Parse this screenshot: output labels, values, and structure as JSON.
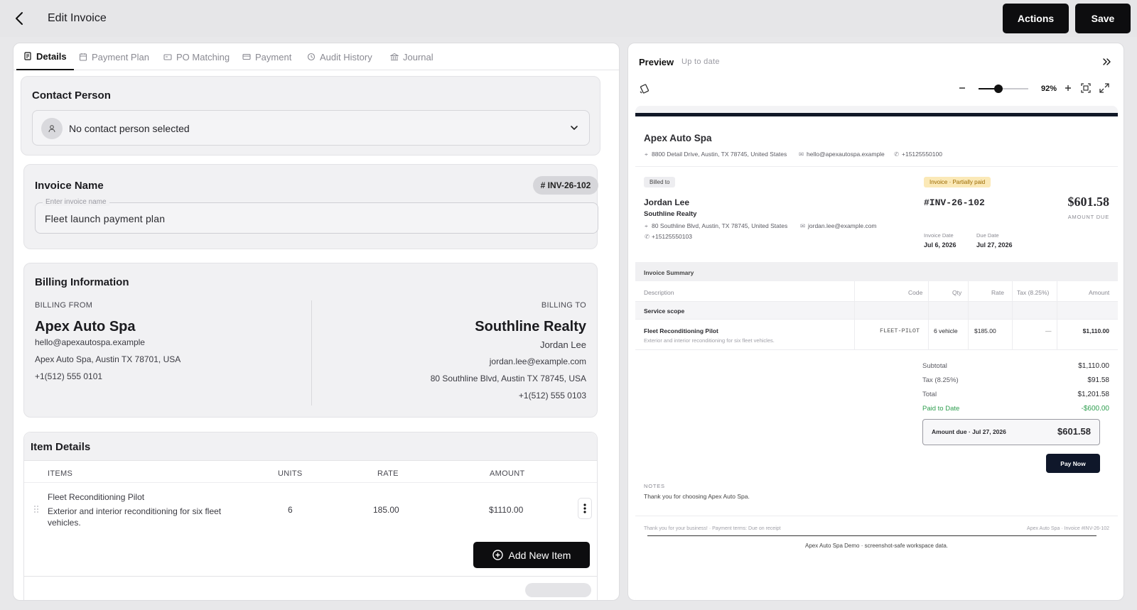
{
  "header": {
    "title": "Edit Invoice",
    "actions_label": "Actions",
    "save_label": "Save"
  },
  "tabs": [
    {
      "label": "Details",
      "icon": "document-icon",
      "active": true
    },
    {
      "label": "Payment Plan",
      "icon": "calendar-icon"
    },
    {
      "label": "PO Matching",
      "icon": "match-icon"
    },
    {
      "label": "Payment",
      "icon": "card-icon"
    },
    {
      "label": "Audit History",
      "icon": "history-icon"
    },
    {
      "label": "Journal",
      "icon": "bank-icon"
    }
  ],
  "contact": {
    "title": "Contact Person",
    "value": "No contact person selected"
  },
  "invoice_name": {
    "title": "Invoice Name",
    "badge": "# INV-26-102",
    "field_label": "Enter invoice name",
    "value": "Fleet launch payment plan"
  },
  "billing": {
    "title": "Billing Information",
    "from": {
      "label": "BILLING FROM",
      "name": "Apex Auto Spa",
      "email": "hello@apexautospa.example",
      "address": "Apex Auto Spa, Austin TX 78701, USA",
      "phone": "+1(512) 555 0101"
    },
    "to": {
      "label": "BILLING TO",
      "name": "Southline Realty",
      "contact": "Jordan Lee",
      "email": "jordan.lee@example.com",
      "address": "80 Southline Blvd, Austin TX 78745, USA",
      "phone": "+1(512) 555 0103"
    }
  },
  "items": {
    "title": "Item Details",
    "headers": {
      "items": "ITEMS",
      "units": "UNITS",
      "rate": "RATE",
      "amount": "AMOUNT"
    },
    "rows": [
      {
        "name": "Fleet Reconditioning Pilot",
        "description_line1": "Exterior and interior reconditioning for six fleet",
        "description_line2": "vehicles.",
        "units": "6",
        "rate": "185.00",
        "amount": "$1110.00"
      }
    ],
    "add_label": "Add New Item"
  },
  "preview": {
    "title": "Preview",
    "status": "Up to date",
    "zoom": "92%",
    "zoom_fraction": 0.4,
    "doc": {
      "company": "Apex Auto Spa",
      "company_address": "8800 Detail Drive, Austin, TX 78745, United States",
      "company_email": "hello@apexautospa.example",
      "company_phone": "+15125550100",
      "billed_to_label": "Billed to",
      "status_pill": "Invoice · Partially paid",
      "client_name": "Jordan Lee",
      "client_company": "Southline Realty",
      "client_address": "80 Southline Blvd, Austin, TX 78745, United States",
      "client_email": "jordan.lee@example.com",
      "client_phone": "+15125550103",
      "invoice_number": "#INV-26-102",
      "amount_due": "$601.58",
      "amount_due_label": "AMOUNT DUE",
      "invoice_date_label": "Invoice Date",
      "invoice_date": "Jul 6, 2026",
      "due_date_label": "Due Date",
      "due_date": "Jul 27, 2026",
      "summary_title": "Invoice Summary",
      "cols": {
        "description": "Description",
        "code": "Code",
        "qty": "Qty",
        "rate": "Rate",
        "tax": "Tax (8.25%)",
        "amount": "Amount"
      },
      "section": "Service scope",
      "line": {
        "name": "Fleet Reconditioning Pilot",
        "desc": "Exterior and interior reconditioning for six fleet vehicles.",
        "code": "FLEET-PILOT",
        "qty": "6 vehicle",
        "rate": "$185.00",
        "tax": "—",
        "amount": "$1,110.00"
      },
      "totals": [
        {
          "label": "Subtotal",
          "value": "$1,110.00"
        },
        {
          "label": "Tax (8.25%)",
          "value": "$91.58"
        },
        {
          "label": "Total",
          "value": "$1,201.58"
        },
        {
          "label": "Paid to Date",
          "value": "-$600.00"
        }
      ],
      "due_box_label": "Amount due · Jul 27, 2026",
      "due_box_value": "$601.58",
      "pay_label": "Pay Now",
      "notes_label": "NOTES",
      "notes_text": "Thank you for choosing Apex Auto Spa.",
      "footer_left": "Thank you for your business! · Payment terms: Due on receipt",
      "footer_right": "Apex Auto Spa · Invoice #INV-26-102",
      "footer_center": "Apex Auto Spa Demo · screenshot-safe workspace data."
    }
  },
  "colors": {
    "accent": "#0d0d0f",
    "paid_green": "#2e9e4f",
    "status_pill_bg": "#fbe9b7",
    "doc_bar": "#111827"
  }
}
